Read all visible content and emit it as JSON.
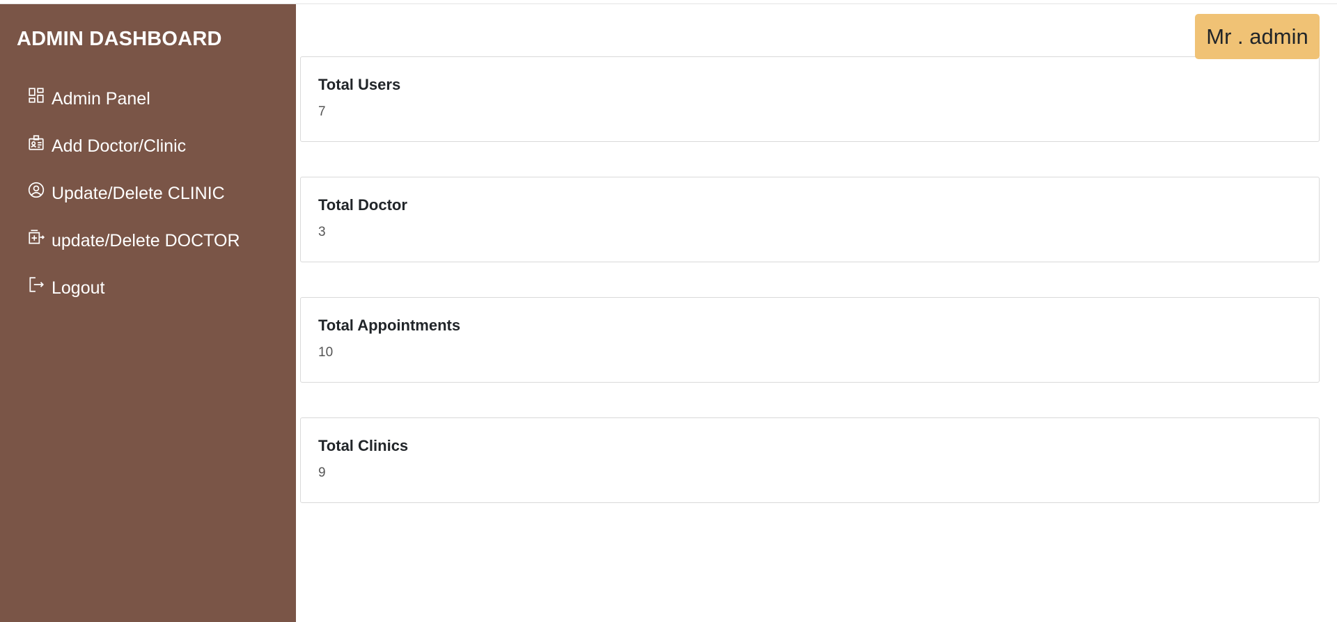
{
  "sidebar": {
    "brand": "ADMIN DASHBOARD",
    "background": "#7a5547",
    "items": [
      {
        "label": "Admin Panel",
        "icon": "grid-icon"
      },
      {
        "label": "Add Doctor/Clinic",
        "icon": "id-card-icon"
      },
      {
        "label": "Update/Delete CLINIC",
        "icon": "user-circle-icon"
      },
      {
        "label": "update/Delete DOCTOR",
        "icon": "hospital-transfer-icon"
      },
      {
        "label": "Logout",
        "icon": "logout-icon"
      }
    ]
  },
  "header": {
    "user_label": "Mr . admin",
    "badge_color": "#f0c275"
  },
  "stats": [
    {
      "title": "Total Users",
      "value": "7"
    },
    {
      "title": "Total Doctor",
      "value": "3"
    },
    {
      "title": "Total Appointments",
      "value": "10"
    },
    {
      "title": "Total Clinics",
      "value": "9"
    }
  ]
}
